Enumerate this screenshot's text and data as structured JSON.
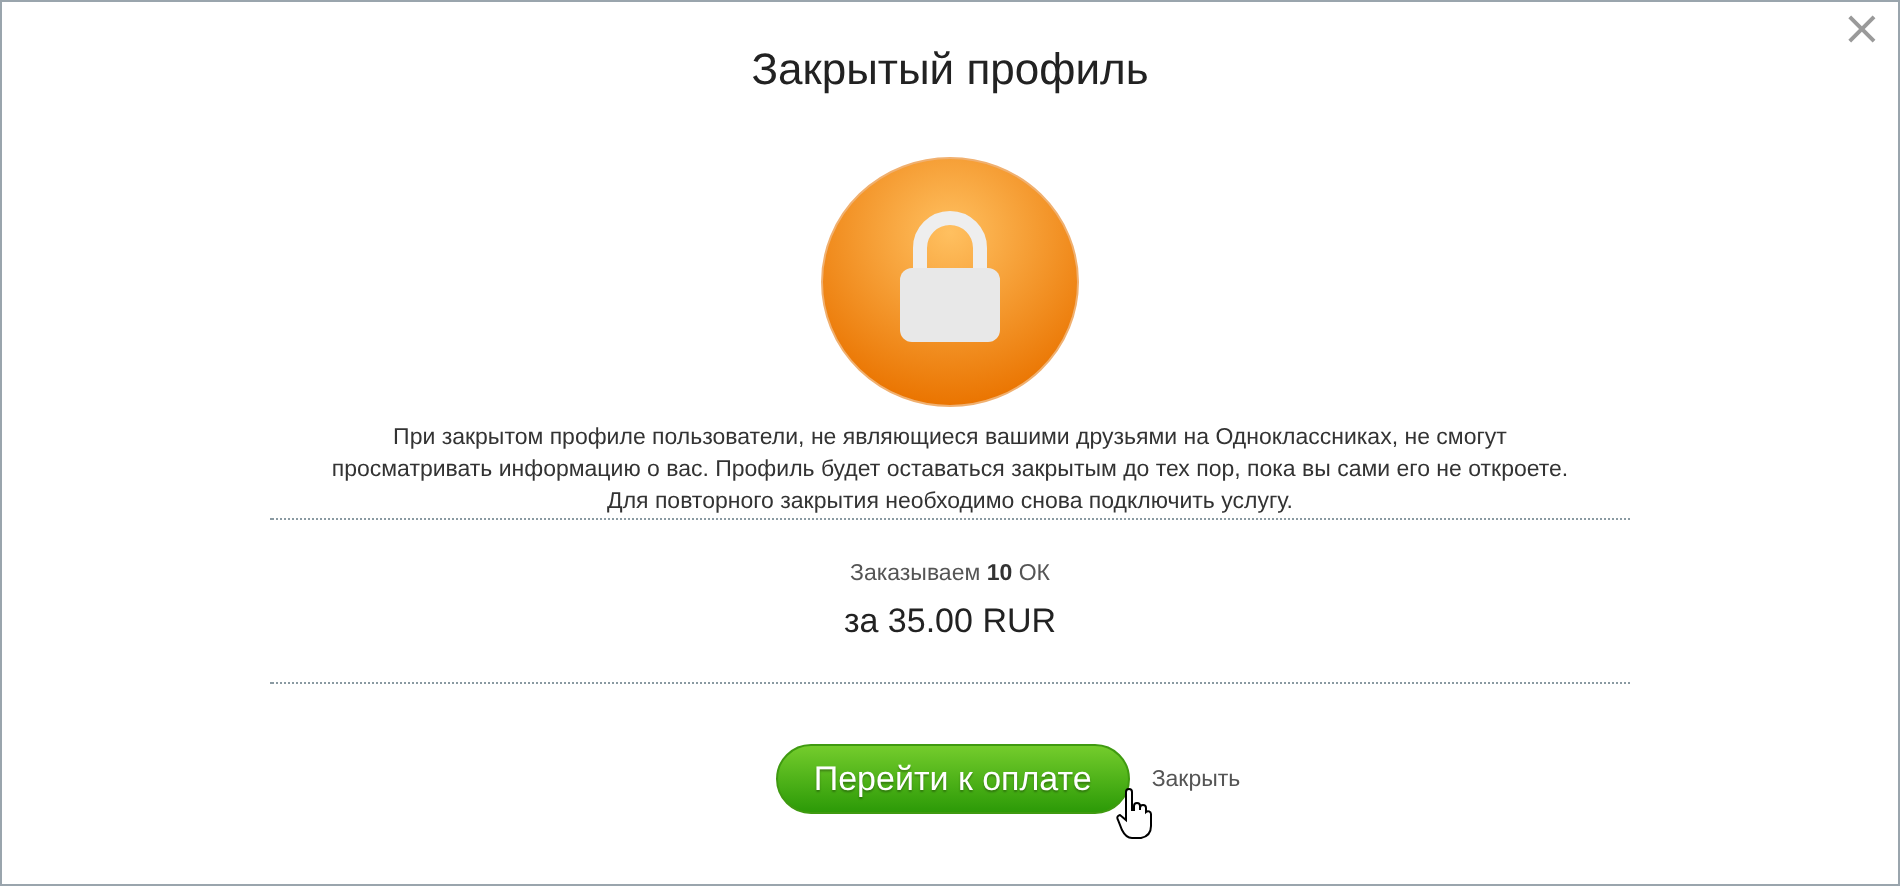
{
  "dialog": {
    "title": "Закрытый профиль",
    "close_symbol": "×",
    "description_lines": [
      "При закрытом профиле пользователи, не являющиеся вашими друзьями на Одноклассниках, не смогут",
      "просматривать информацию о вас. Профиль будет оставаться закрытым до тех пор, пока вы сами его не откроете.",
      "Для повторного закрытия необходимо снова подключить услугу."
    ],
    "order": "Заказываем **10** ОК",
    "price": "за 35.00 RUR",
    "buttons": [
      {
        "kind": "primary",
        "label": "Перейти к оплате"
      },
      {
        "kind": "link",
        "label": "Закрыть"
      }
    ]
  }
}
